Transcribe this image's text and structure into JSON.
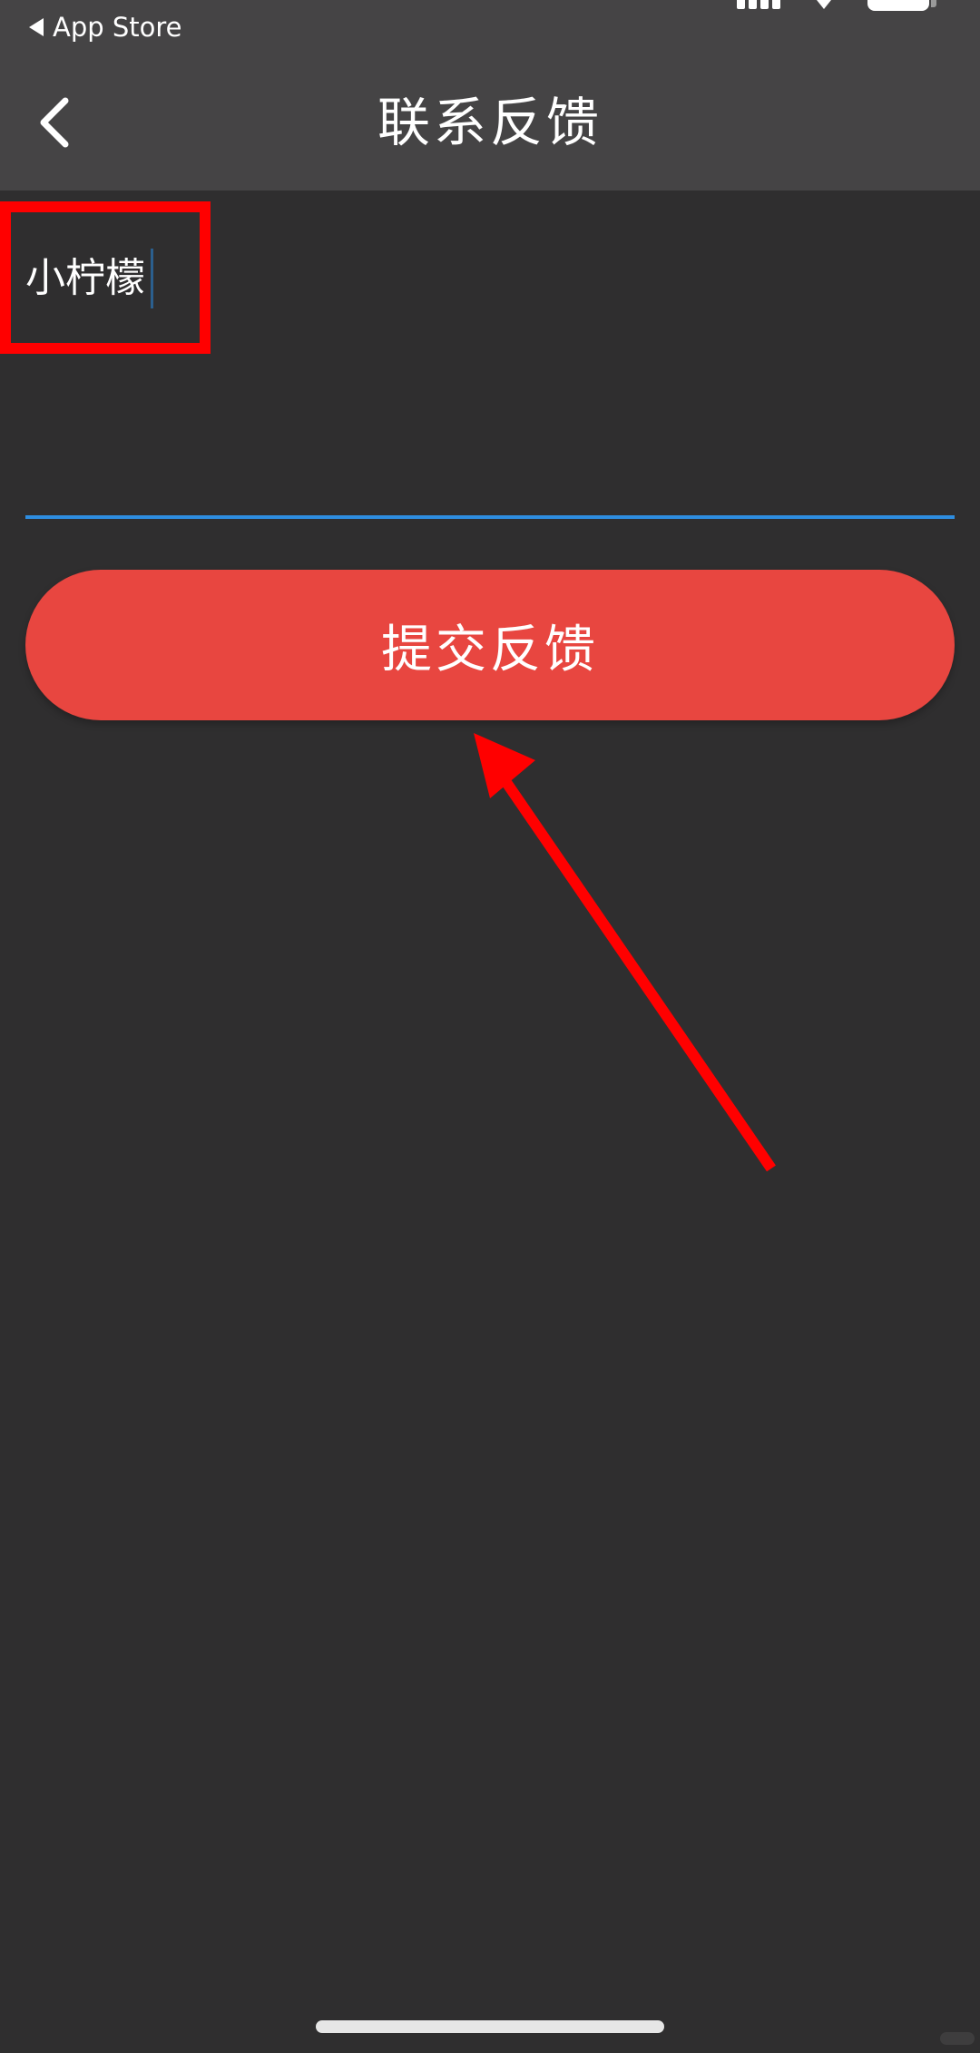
{
  "status_bar": {
    "back_label": "App Store"
  },
  "nav": {
    "title": "联系反馈",
    "back_icon": "chevron-left-icon"
  },
  "feedback": {
    "value": "小柠檬"
  },
  "submit": {
    "label": "提交反馈"
  },
  "colors": {
    "header_bg": "#454445",
    "page_bg": "#2f2e2f",
    "underline": "#2e8de0",
    "button": "#e84640",
    "annotation": "#ff0000"
  }
}
